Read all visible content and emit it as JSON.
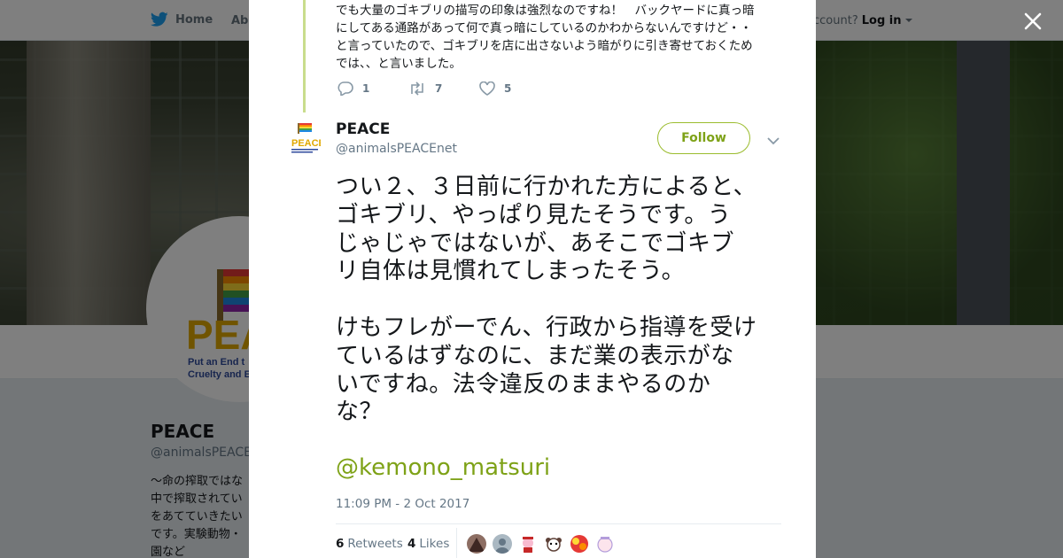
{
  "nav": {
    "home_label": "Home",
    "about_label": "Abo",
    "account_prompt": "ccount?",
    "login_label": "Log in"
  },
  "profile": {
    "name": "PEACE",
    "handle": "@animalsPEACEn",
    "bio": "～命の搾取ではな\n中で搾取されてい\nをあてていきたい\nです。実験動物・\n園など",
    "avatar_text": "PEA",
    "avatar_sub1": "Put an End t",
    "avatar_sub2": "Cruelty and Ex"
  },
  "previous_tweet": {
    "text": "でも大量のゴキブリの描写の印象は強烈なのですね！　バックヤードに真っ暗\nにしてある通路があって何で真っ暗にしているのかわからないんですけど・・\nと言っていたので、ゴキブリを店に出さないよう暗がりに引き寄せておくため\nでは、、と言いました。",
    "replies": "1",
    "retweets": "7",
    "likes": "5"
  },
  "tweet": {
    "name": "PEACE",
    "handle": "@animalsPEACEnet",
    "avatar_text": "PEACE",
    "follow_label": "Follow",
    "text": "つい２、３日前に行かれた方によると、\nゴキブリ、やっぱり見たそうです。う\nじゃじゃではないが、あそこでゴキブ\nリ自体は見慣れてしまったそう。\n\nけもフレがーでん、行政から指導を受け\nているはずなのに、まだ業の表示がな\nいですね。法令違反のままやるのか\nな？",
    "mention": "@kemono_matsuri",
    "timestamp": "11:09 PM - 2 Oct 2017",
    "retweet_count": "6",
    "retweet_label": "Retweets",
    "like_count": "4",
    "like_label": "Likes"
  },
  "colors": {
    "accent": "#7ea217",
    "twitter_blue": "#1da1f2",
    "text": "#14171a",
    "muted": "#657786"
  }
}
